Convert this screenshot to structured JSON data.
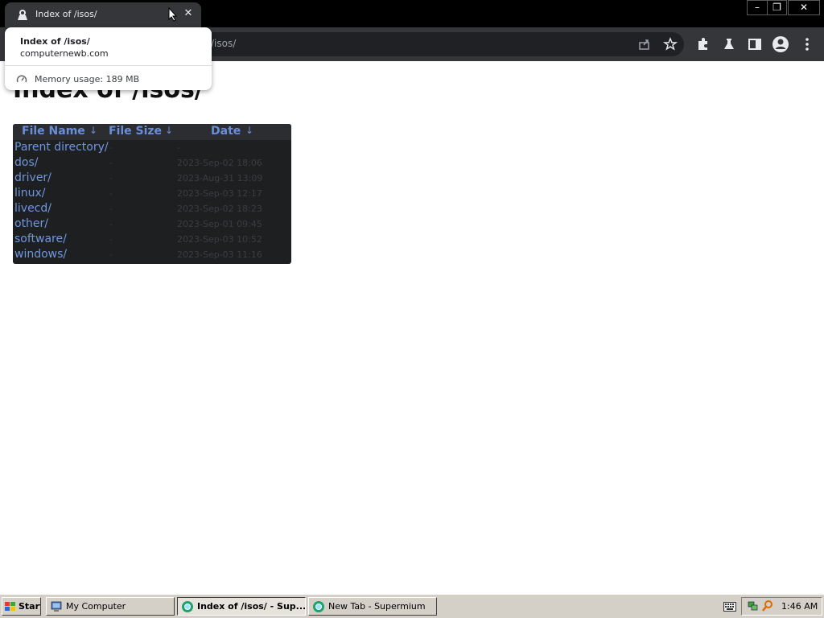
{
  "browser": {
    "tab_title": "Index of /isos/",
    "tab_close": "✕",
    "address_text": "/isos/",
    "window_controls": {
      "minimize": "–",
      "maximize": "❐",
      "close": "✕"
    },
    "toolbar_icons": [
      "share-icon",
      "star-icon",
      "extensions-icon",
      "labs-icon",
      "side-panel-icon",
      "profile-icon",
      "menu-icon"
    ]
  },
  "hovercard": {
    "title": "Index of /isos/",
    "domain": "computernewb.com",
    "memory": "Memory usage: 189 MB"
  },
  "page": {
    "heading": "Index of /isos/",
    "listing": {
      "headers": {
        "name": "File Name",
        "size": "File Size",
        "date": "Date",
        "arrow": "↓"
      },
      "rows": [
        {
          "name": "Parent directory/",
          "size": "-",
          "date": "-"
        },
        {
          "name": "dos/",
          "size": "-",
          "date": "2023-Sep-02 18:06"
        },
        {
          "name": "driver/",
          "size": "-",
          "date": "2023-Aug-31 13:09"
        },
        {
          "name": "linux/",
          "size": "-",
          "date": "2023-Sep-03 12:17"
        },
        {
          "name": "livecd/",
          "size": "-",
          "date": "2023-Sep-02 18:23"
        },
        {
          "name": "other/",
          "size": "-",
          "date": "2023-Sep-01 09:45"
        },
        {
          "name": "software/",
          "size": "-",
          "date": "2023-Sep-03 10:52"
        },
        {
          "name": "windows/",
          "size": "-",
          "date": "2023-Sep-03 11:16"
        }
      ]
    }
  },
  "taskbar": {
    "start_label": "Start",
    "buttons": [
      {
        "label": "My Computer",
        "active": false
      },
      {
        "label": "Index of /isos/ - Sup...",
        "active": true
      },
      {
        "label": "New Tab - Supermium",
        "active": false
      }
    ],
    "clock": "1:46 AM"
  },
  "colors": {
    "link": "#7096de",
    "header_text": "#6a8fd8",
    "table_bg": "#1e1f21",
    "chrome_dark": "#35363a",
    "taskbar": "#d4d0c8"
  }
}
